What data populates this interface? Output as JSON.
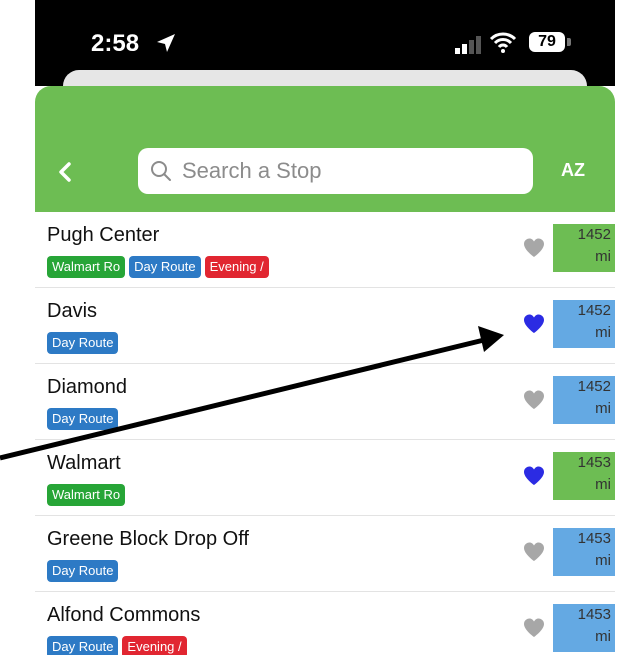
{
  "status": {
    "time": "2:58",
    "battery": "79"
  },
  "header": {
    "search_placeholder": "Search a Stop",
    "sort_label": "AZ"
  },
  "colors": {
    "header_green": "#6dbd53",
    "tag_green": "#27a537",
    "tag_blue": "#2d7ac5",
    "tag_red": "#e12631",
    "heart_active": "#2b2be3",
    "heart_inactive": "#a7a7a7",
    "distance_green": "#6dbd53",
    "distance_blue": "#64a9e3"
  },
  "stops": [
    {
      "name": "Pugh Center",
      "favorite": false,
      "distance": [
        "1452",
        "mi"
      ],
      "distance_color": "green",
      "tags": [
        {
          "label": "Walmart Ro",
          "color": "green"
        },
        {
          "label": "Day Route",
          "color": "blue"
        },
        {
          "label": "Evening /",
          "color": "red"
        }
      ]
    },
    {
      "name": "Davis",
      "favorite": true,
      "distance": [
        "1452",
        "mi"
      ],
      "distance_color": "blue",
      "tags": [
        {
          "label": "Day Route",
          "color": "blue"
        }
      ]
    },
    {
      "name": "Diamond",
      "favorite": false,
      "distance": [
        "1452",
        "mi"
      ],
      "distance_color": "blue",
      "tags": [
        {
          "label": "Day Route",
          "color": "blue"
        }
      ]
    },
    {
      "name": "Walmart",
      "favorite": true,
      "distance": [
        "1453",
        "mi"
      ],
      "distance_color": "green",
      "tags": [
        {
          "label": "Walmart Ro",
          "color": "green"
        }
      ]
    },
    {
      "name": "Greene Block Drop Off",
      "favorite": false,
      "distance": [
        "1453",
        "mi"
      ],
      "distance_color": "blue",
      "tags": [
        {
          "label": "Day Route",
          "color": "blue"
        }
      ]
    },
    {
      "name": "Alfond Commons",
      "favorite": false,
      "distance": [
        "1453",
        "mi"
      ],
      "distance_color": "blue",
      "tags": [
        {
          "label": "Day Route",
          "color": "blue"
        },
        {
          "label": "Evening /",
          "color": "red"
        }
      ]
    }
  ]
}
